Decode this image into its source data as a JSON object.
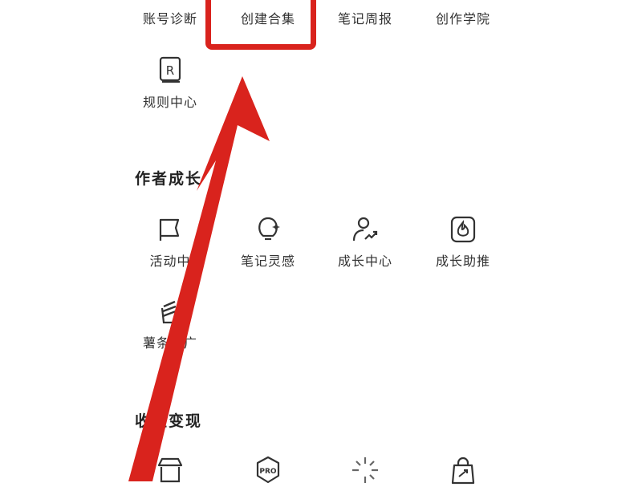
{
  "top_row": [
    {
      "label": "账号诊断",
      "icon": "diagnosis-icon"
    },
    {
      "label": "创建合集",
      "icon": "collection-icon"
    },
    {
      "label": "笔记周报",
      "icon": "weekly-report-icon"
    },
    {
      "label": "创作学院",
      "icon": "academy-icon"
    }
  ],
  "rules": {
    "label": "规则中心",
    "icon": "rules-icon"
  },
  "growth": {
    "title": "作者成长",
    "items": [
      {
        "label": "活动中",
        "icon": "flag-icon"
      },
      {
        "label": "笔记灵感",
        "icon": "lightbulb-icon"
      },
      {
        "label": "成长中心",
        "icon": "user-growth-icon"
      },
      {
        "label": "成长助推",
        "icon": "flame-icon"
      },
      {
        "label": "薯条推广",
        "icon": "fries-icon"
      }
    ]
  },
  "monetize": {
    "title": "收益变现",
    "items": [
      {
        "label": "",
        "icon": "shop-icon"
      },
      {
        "label": "PRO",
        "icon": "pro-icon"
      },
      {
        "label": "",
        "icon": "sparkle-icon"
      },
      {
        "label": "",
        "icon": "shopping-bag-icon"
      }
    ]
  },
  "colors": {
    "annotation_red": "#d9231d",
    "text": "#333333"
  }
}
